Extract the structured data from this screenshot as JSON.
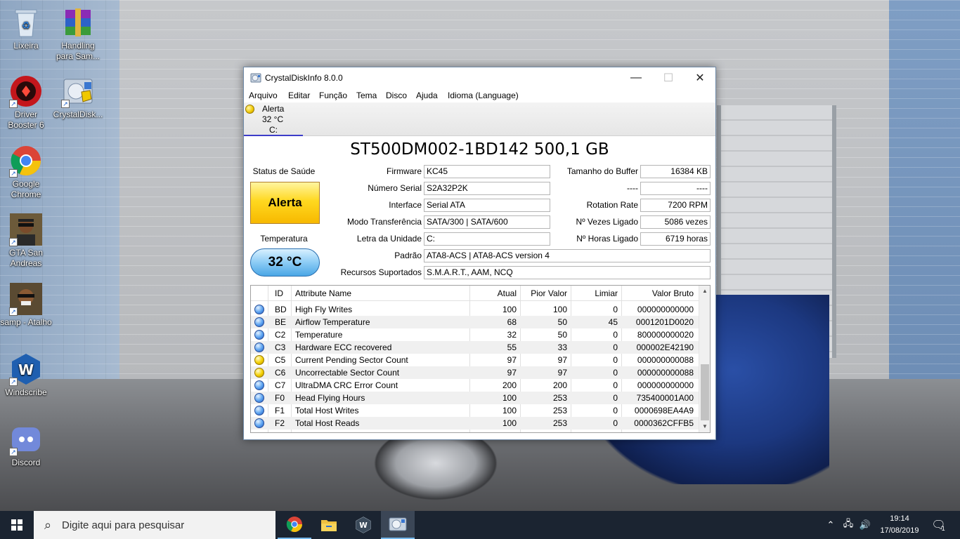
{
  "desktop": {
    "icons": [
      {
        "label": "Lixeira",
        "icon": "recycle-bin-icon"
      },
      {
        "label": "Handling para Sam...",
        "icon": "winrar-archive-icon"
      },
      {
        "label": "Driver Booster 6",
        "icon": "driver-booster-icon"
      },
      {
        "label": "CrystalDisk...",
        "icon": "crystaldiskinfo-icon"
      },
      {
        "label": "Google Chrome",
        "icon": "chrome-icon"
      },
      {
        "label": "GTA San Andreas",
        "icon": "gta-sa-icon"
      },
      {
        "label": "samp - Atalho",
        "icon": "samp-icon"
      },
      {
        "label": "Windscribe",
        "icon": "windscribe-icon"
      },
      {
        "label": "Discord",
        "icon": "discord-icon"
      }
    ]
  },
  "window": {
    "title": "CrystalDiskInfo 8.0.0",
    "menu": [
      "Arquivo",
      "Editar",
      "Função",
      "Tema",
      "Disco",
      "Ajuda",
      "Idioma (Language)"
    ],
    "disk_tab": {
      "status": "Alerta",
      "temp": "32 °C",
      "drive": "C:"
    },
    "model": "ST500DM002-1BD142 500,1 GB",
    "health_label": "Status de Saúde",
    "health_value": "Alerta",
    "temp_label": "Temperatura",
    "temp_value": "32 °C",
    "info": {
      "firmware_label": "Firmware",
      "firmware": "KC45",
      "serial_label": "Número Serial",
      "serial": "S2A32P2K",
      "interface_label": "Interface",
      "interface": "Serial ATA",
      "transfer_label": "Modo Transferência",
      "transfer": "SATA/300 | SATA/600",
      "drive_letter_label": "Letra da Unidade",
      "drive_letter": "C:",
      "standard_label": "Padrão",
      "standard": "ATA8-ACS | ATA8-ACS version 4",
      "features_label": "Recursos Suportados",
      "features": "S.M.A.R.T., AAM, NCQ",
      "buffer_label": "Tamanho do Buffer",
      "buffer": "16384 KB",
      "blank_label": "----",
      "blank": "----",
      "rotation_label": "Rotation Rate",
      "rotation": "7200 RPM",
      "power_count_label": "Nº Vezes Ligado",
      "power_count": "5086 vezes",
      "power_hours_label": "Nº Horas Ligado",
      "power_hours": "6719 horas"
    },
    "table": {
      "headers": [
        "ID",
        "Attribute Name",
        "Atual",
        "Pior Valor",
        "Limiar",
        "Valor Bruto"
      ],
      "rows": [
        {
          "status": "blue",
          "id": "BD",
          "name": "High Fly Writes",
          "current": "100",
          "worst": "100",
          "threshold": "0",
          "raw": "000000000000"
        },
        {
          "status": "blue",
          "id": "BE",
          "name": "Airflow Temperature",
          "current": "68",
          "worst": "50",
          "threshold": "45",
          "raw": "0001201D0020"
        },
        {
          "status": "blue",
          "id": "C2",
          "name": "Temperature",
          "current": "32",
          "worst": "50",
          "threshold": "0",
          "raw": "800000000020"
        },
        {
          "status": "blue",
          "id": "C3",
          "name": "Hardware ECC recovered",
          "current": "55",
          "worst": "33",
          "threshold": "0",
          "raw": "000002E42190"
        },
        {
          "status": "yellow",
          "id": "C5",
          "name": "Current Pending Sector Count",
          "current": "97",
          "worst": "97",
          "threshold": "0",
          "raw": "000000000088"
        },
        {
          "status": "yellow",
          "id": "C6",
          "name": "Uncorrectable Sector Count",
          "current": "97",
          "worst": "97",
          "threshold": "0",
          "raw": "000000000088"
        },
        {
          "status": "blue",
          "id": "C7",
          "name": "UltraDMA CRC Error Count",
          "current": "200",
          "worst": "200",
          "threshold": "0",
          "raw": "000000000000"
        },
        {
          "status": "blue",
          "id": "F0",
          "name": "Head Flying Hours",
          "current": "100",
          "worst": "253",
          "threshold": "0",
          "raw": "735400001A00"
        },
        {
          "status": "blue",
          "id": "F1",
          "name": "Total Host Writes",
          "current": "100",
          "worst": "253",
          "threshold": "0",
          "raw": "0000698EA4A9"
        },
        {
          "status": "blue",
          "id": "F2",
          "name": "Total Host Reads",
          "current": "100",
          "worst": "253",
          "threshold": "0",
          "raw": "0000362CFFB5"
        }
      ]
    }
  },
  "taskbar": {
    "search_placeholder": "Digite aqui para pesquisar",
    "apps": [
      "chrome-icon",
      "file-explorer-icon",
      "windscribe-icon",
      "crystaldiskinfo-icon"
    ],
    "time": "19:14",
    "date": "17/08/2019",
    "notification_count": "1"
  }
}
